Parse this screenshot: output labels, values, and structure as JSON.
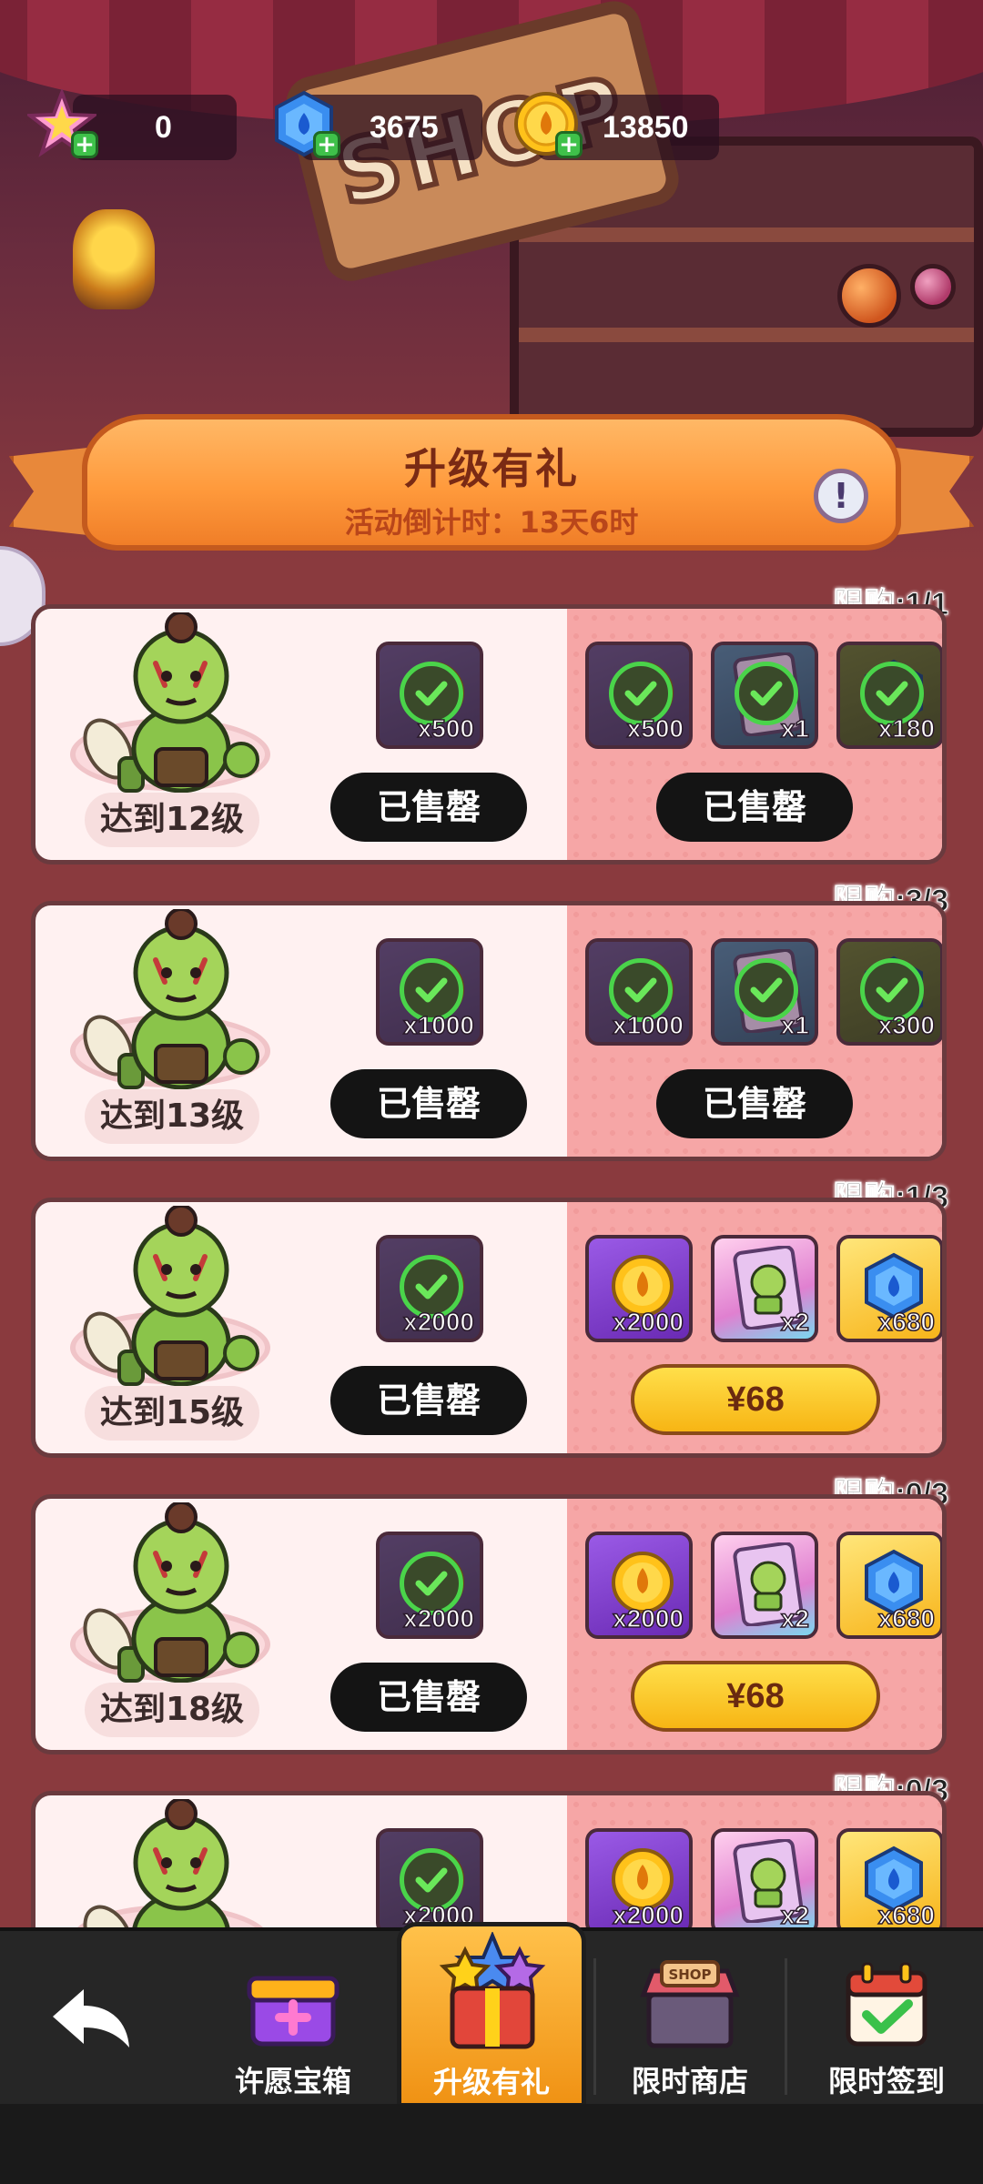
{
  "currencies": [
    {
      "name": "star",
      "value": "0"
    },
    {
      "name": "gem",
      "value": "3675"
    },
    {
      "name": "coin",
      "value": "13850"
    }
  ],
  "scene": {
    "shop_sign": "SHOP"
  },
  "banner": {
    "title": "升级有礼",
    "countdown": "活动倒计时：13天6时",
    "info": "!"
  },
  "cards": [
    {
      "limit": "限购:1/1",
      "level": "达到12级",
      "free_reward": {
        "qty": "x500",
        "claimed": true
      },
      "free_button": "已售罄",
      "paid_rewards": [
        {
          "type": "coin",
          "qty": "x500",
          "claimed": true
        },
        {
          "type": "card",
          "qty": "x1",
          "claimed": true
        },
        {
          "type": "gem",
          "qty": "x180",
          "claimed": true
        }
      ],
      "paid_button": "已售罄",
      "paid_sold_out": true
    },
    {
      "limit": "限购:3/3",
      "level": "达到13级",
      "free_reward": {
        "qty": "x1000",
        "claimed": true
      },
      "free_button": "已售罄",
      "paid_rewards": [
        {
          "type": "coin",
          "qty": "x1000",
          "claimed": true
        },
        {
          "type": "card",
          "qty": "x1",
          "claimed": true
        },
        {
          "type": "gem",
          "qty": "x300",
          "claimed": true
        }
      ],
      "paid_button": "已售罄",
      "paid_sold_out": true
    },
    {
      "limit": "限购:1/3",
      "level": "达到15级",
      "free_reward": {
        "qty": "x2000",
        "claimed": true
      },
      "free_button": "已售罄",
      "paid_rewards": [
        {
          "type": "coin",
          "qty": "x2000",
          "claimed": false
        },
        {
          "type": "card",
          "qty": "x2",
          "claimed": false
        },
        {
          "type": "gem",
          "qty": "x680",
          "claimed": false
        }
      ],
      "paid_button": "¥68",
      "paid_sold_out": false
    },
    {
      "limit": "限购:0/3",
      "level": "达到18级",
      "free_reward": {
        "qty": "x2000",
        "claimed": true
      },
      "free_button": "已售罄",
      "paid_rewards": [
        {
          "type": "coin",
          "qty": "x2000",
          "claimed": false
        },
        {
          "type": "card",
          "qty": "x2",
          "claimed": false
        },
        {
          "type": "gem",
          "qty": "x680",
          "claimed": false
        }
      ],
      "paid_button": "¥68",
      "paid_sold_out": false
    },
    {
      "limit": "限购:0/3",
      "level": "",
      "free_reward": {
        "qty": "x2000",
        "claimed": true
      },
      "free_button": "",
      "paid_rewards": [
        {
          "type": "coin",
          "qty": "x2000",
          "claimed": false
        },
        {
          "type": "card",
          "qty": "x2",
          "claimed": false
        },
        {
          "type": "gem",
          "qty": "x680",
          "claimed": false
        }
      ],
      "paid_button": "",
      "paid_sold_out": false
    }
  ],
  "nav": {
    "back_icon": "back-arrow-icon",
    "items": [
      {
        "label": "许愿宝箱",
        "icon": "wish-chest-icon",
        "active": false
      },
      {
        "label": "升级有礼",
        "icon": "gift-box-icon",
        "active": true
      },
      {
        "label": "限时商店",
        "icon": "shop-stall-icon",
        "active": false
      },
      {
        "label": "限时签到",
        "icon": "calendar-check-icon",
        "active": false
      }
    ]
  },
  "colors": {
    "banner": "#ff9a3c",
    "price_button": "#f7b514",
    "sold_button": "#141414",
    "card_paid_panel": "#f6a6a6"
  }
}
